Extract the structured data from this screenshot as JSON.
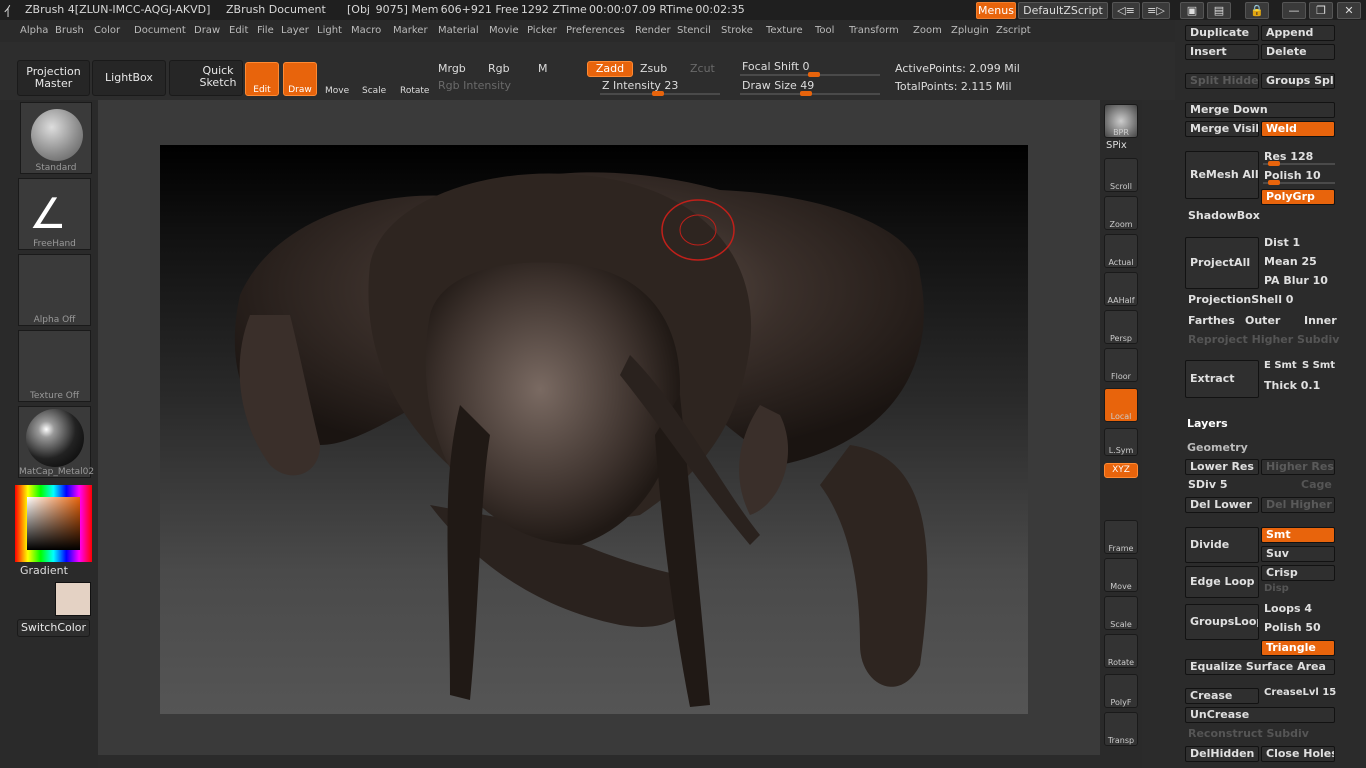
{
  "title": {
    "app": "ZBrush 4[ZLUN-IMCC-AQGJ-AKVD]",
    "doc": "ZBrush Document",
    "stats": "[Obj  9075]  Mem 606+921  Free 1292  ZTime 00:00:07.09  RTime 00:02:35",
    "menus_btn": "Menus",
    "script_btn": "DefaultZScript"
  },
  "menus": [
    "Alpha",
    "Brush",
    "Color",
    "Document",
    "Draw",
    "Edit",
    "File",
    "Layer",
    "Light",
    "Macro",
    "Marker",
    "Material",
    "Movie",
    "Picker",
    "Preferences",
    "Render",
    "Stencil",
    "Stroke",
    "Texture",
    "Tool",
    "Transform",
    "Zoom",
    "Zplugin",
    "Zscript"
  ],
  "toolbar": {
    "projection_master": "Projection Master",
    "lightbox": "LightBox",
    "quick_sketch": "Quick Sketch",
    "edit": "Edit",
    "draw": "Draw",
    "move": "Move",
    "scale": "Scale",
    "rotate": "Rotate",
    "mrgb": "Mrgb",
    "rgb": "Rgb",
    "m": "M",
    "zadd": "Zadd",
    "zsub": "Zsub",
    "zcut": "Zcut",
    "rgb_intensity": "Rgb Intensity",
    "z_intensity": "Z Intensity 23",
    "focal_shift": "Focal Shift 0",
    "draw_size": "Draw Size 49",
    "active_points": "ActivePoints: 2.099 Mil",
    "total_points": "TotalPoints: 2.115 Mil"
  },
  "left": {
    "brush": "Standard",
    "stroke": "FreeHand",
    "alpha": "Alpha Off",
    "texture": "Texture Off",
    "material": "MatCap_Metal02",
    "gradient": "Gradient",
    "switchcolor": "SwitchColor"
  },
  "right_shelf": [
    "BPR",
    "SPix",
    "Scroll",
    "Zoom",
    "Actual",
    "AAHalf",
    "Persp",
    "Floor",
    "Local",
    "L.Sym",
    "XYZ",
    "Frame",
    "Move",
    "Scale",
    "Rotate",
    "PolyF",
    "Transp"
  ],
  "panel": {
    "duplicate": "Duplicate",
    "append": "Append",
    "insert": "Insert",
    "delete": "Delete",
    "split_hidden": "Split Hidden",
    "groups_split": "Groups Split",
    "merge_down": "Merge Down",
    "merge_visible": "Merge Visibl",
    "weld": "Weld",
    "remesh_all": "ReMesh All",
    "res": "Res 128",
    "polish": "Polish 10",
    "polygrp": "PolyGrp",
    "shadowbox": "ShadowBox",
    "projectall": "ProjectAll",
    "dist": "Dist 1",
    "mean": "Mean 25",
    "pa_blur": "PA Blur 10",
    "projection_shell": "ProjectionShell 0",
    "farthest": "Farthes",
    "outer": "Outer",
    "inner": "Inner",
    "reproject": "Reproject Higher Subdiv",
    "extract": "Extract",
    "e_smt": "E Smt",
    "s_smt": "S Smt",
    "thick": "Thick 0.1",
    "layers": "Layers",
    "geometry": "Geometry",
    "lower_res": "Lower Res",
    "higher_res": "Higher Res",
    "sdiv": "SDiv 5",
    "cage": "Cage",
    "del_lower": "Del Lower",
    "del_higher": "Del Higher",
    "divide": "Divide",
    "smt": "Smt",
    "suv": "Suv",
    "edge_loop": "Edge Loop",
    "crisp": "Crisp",
    "disp": "Disp",
    "groupsloops": "GroupsLoops",
    "loops": "Loops 4",
    "polish50": "Polish 50",
    "triangle": "Triangle",
    "equalize": "Equalize Surface Area",
    "crease": "Crease",
    "crease_lvl": "CreaseLvl 15",
    "uncrease": "UnCrease",
    "reconstruct": "Reconstruct Subdiv",
    "delhidden": "DelHidden",
    "close_holes": "Close Holes"
  },
  "colors": {
    "accent": "#e8640c",
    "bg": "#2b2b2b",
    "canvas": "#3a3a3a"
  }
}
